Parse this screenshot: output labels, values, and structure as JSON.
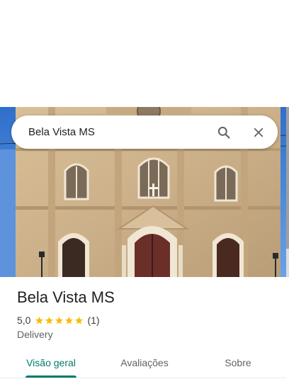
{
  "search": {
    "query": "Bela Vista MS"
  },
  "place": {
    "name": "Bela Vista MS",
    "rating": "5,0",
    "stars": 5,
    "review_count": "(1)",
    "category": "Delivery"
  },
  "tabs": [
    {
      "label": "Visão geral",
      "active": true
    },
    {
      "label": "Avaliações",
      "active": false
    },
    {
      "label": "Sobre",
      "active": false
    }
  ],
  "colors": {
    "accent": "#00796b",
    "star": "#fbbc04",
    "sky": "#3f7fd1",
    "facade": "#cdb28c"
  }
}
